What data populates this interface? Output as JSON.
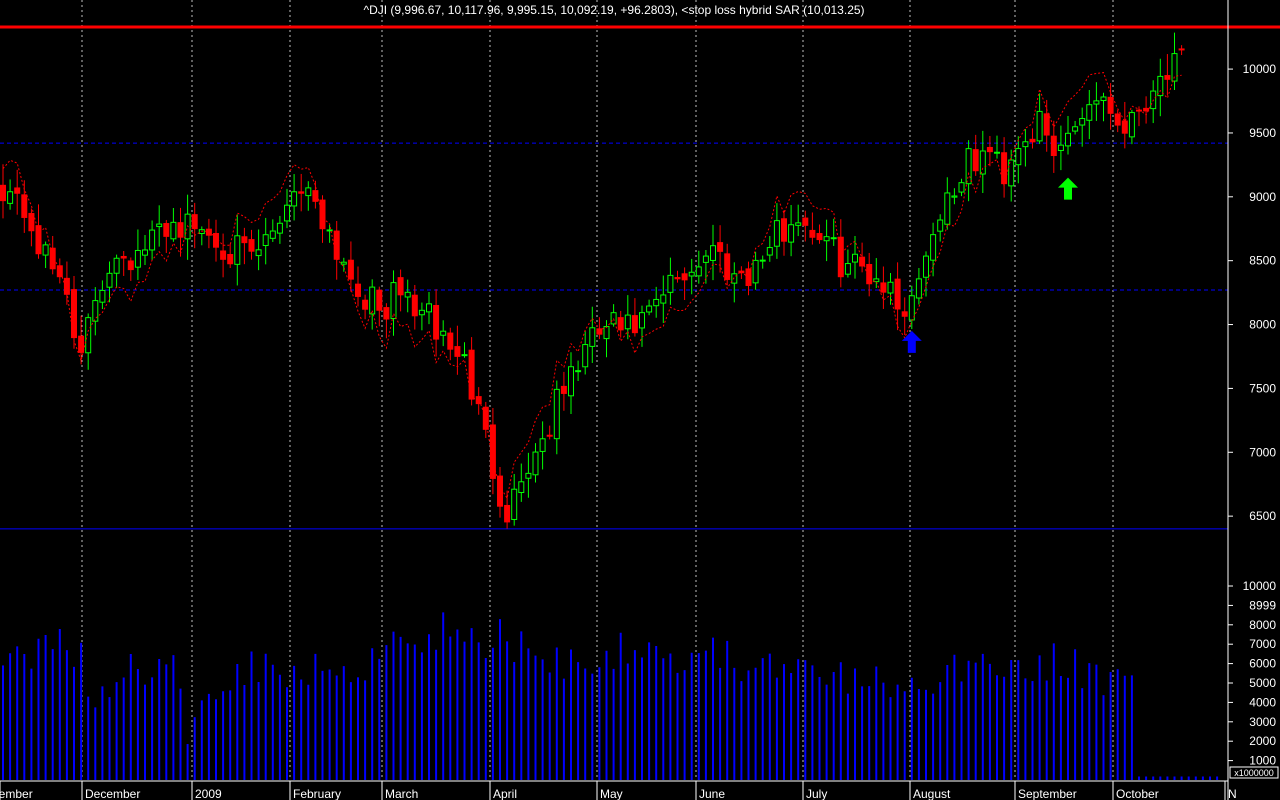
{
  "title": "^DJI (9,996.67, 10,117.96, 9,995.15, 10,092.19, +96.2803), <stop loss hybrid SAR (10,013.25)",
  "colors": {
    "background": "#000000",
    "up": "#00ff00",
    "down": "#ff0000",
    "sar": "#ff0000",
    "volume": "#0000ff",
    "hline": "#0000ff",
    "topline": "#ff0000",
    "grid": "#ffffff",
    "arrow_buy_blue": "#0000ff",
    "arrow_buy_green": "#00ff00"
  },
  "chart_data": [
    {
      "type": "candlestick",
      "series_name": "^DJI",
      "period": "2008-11 to 2009-10",
      "y_ticks": [
        6500,
        7000,
        7500,
        8000,
        8500,
        9000,
        9500,
        10000
      ],
      "ylim": [
        6000,
        10400
      ],
      "x_months": [
        "November",
        "December",
        "2009",
        "February",
        "March",
        "April",
        "May",
        "June",
        "July",
        "August",
        "September",
        "October",
        "N"
      ],
      "price_path": [
        [
          0,
          9100
        ],
        [
          3,
          8900
        ],
        [
          6,
          8500
        ],
        [
          9,
          8300
        ],
        [
          11,
          7700
        ],
        [
          13,
          8200
        ],
        [
          16,
          8600
        ],
        [
          19,
          8500
        ],
        [
          23,
          8800
        ],
        [
          28,
          8750
        ],
        [
          32,
          8600
        ],
        [
          35,
          8500
        ],
        [
          38,
          8700
        ],
        [
          41,
          9100
        ],
        [
          44,
          9000
        ],
        [
          47,
          8600
        ],
        [
          50,
          8300
        ],
        [
          53,
          8100
        ],
        [
          56,
          8250
        ],
        [
          59,
          8100
        ],
        [
          62,
          7900
        ],
        [
          65,
          7700
        ],
        [
          67,
          7300
        ],
        [
          69,
          6900
        ],
        [
          70,
          6700
        ],
        [
          71,
          6550
        ],
        [
          73,
          6800
        ],
        [
          76,
          7100
        ],
        [
          79,
          7500
        ],
        [
          82,
          7800
        ],
        [
          85,
          8000
        ],
        [
          88,
          7950
        ],
        [
          91,
          8050
        ],
        [
          94,
          8300
        ],
        [
          97,
          8450
        ],
        [
          100,
          8600
        ],
        [
          103,
          8400
        ],
        [
          106,
          8450
        ],
        [
          109,
          8700
        ],
        [
          112,
          8850
        ],
        [
          115,
          8700
        ],
        [
          118,
          8500
        ],
        [
          121,
          8450
        ],
        [
          124,
          8350
        ],
        [
          126,
          8150
        ],
        [
          128,
          8200
        ],
        [
          130,
          8600
        ],
        [
          133,
          9000
        ],
        [
          136,
          9250
        ],
        [
          139,
          9350
        ],
        [
          141,
          9200
        ],
        [
          143,
          9450
        ],
        [
          146,
          9550
        ],
        [
          148,
          9300
        ],
        [
          150,
          9500
        ],
        [
          153,
          9750
        ],
        [
          155,
          9800
        ],
        [
          157,
          9600
        ],
        [
          159,
          9600
        ],
        [
          161,
          9800
        ],
        [
          164,
          10000
        ],
        [
          166,
          10050
        ]
      ],
      "sar_start_offset": 250,
      "annotations": [
        {
          "label": "blue-up-arrow",
          "meaning": "buy signal",
          "date": "July",
          "at_bar": 128,
          "below_price": 7950,
          "color": "#0000ff"
        },
        {
          "label": "green-up-arrow",
          "meaning": "buy signal",
          "date": "September",
          "at_bar": 150,
          "below_price": 9150,
          "color": "#00ff00"
        }
      ],
      "horizontal_lines": [
        {
          "value": 10330,
          "color": "#ff0000",
          "style": "solid"
        },
        {
          "value": 9420,
          "color": "#0000ff",
          "style": "dashed"
        },
        {
          "value": 8270,
          "color": "#0000ff",
          "style": "dashed"
        },
        {
          "value": 6400,
          "color": "#0000ff",
          "style": "solid"
        }
      ]
    },
    {
      "type": "bar",
      "series_name": "Volume",
      "unit_label": "x1000000",
      "y_ticks": [
        1000,
        2000,
        3000,
        4000,
        5000,
        6000,
        7000,
        8000,
        8999,
        10000
      ],
      "ylim": [
        0,
        10000
      ],
      "volume_path": [
        [
          0,
          6000
        ],
        [
          5,
          6400
        ],
        [
          8,
          9300
        ],
        [
          11,
          6200
        ],
        [
          13,
          3500
        ],
        [
          16,
          6100
        ],
        [
          20,
          5500
        ],
        [
          24,
          6000
        ],
        [
          26,
          2200
        ],
        [
          28,
          4500
        ],
        [
          31,
          5500
        ],
        [
          36,
          6300
        ],
        [
          41,
          5600
        ],
        [
          46,
          5900
        ],
        [
          51,
          6200
        ],
        [
          55,
          7700
        ],
        [
          58,
          7800
        ],
        [
          62,
          7900
        ],
        [
          65,
          7500
        ],
        [
          68,
          7000
        ],
        [
          71,
          7700
        ],
        [
          73,
          6900
        ],
        [
          75,
          6300
        ],
        [
          78,
          6600
        ],
        [
          81,
          6100
        ],
        [
          84,
          6400
        ],
        [
          88,
          7500
        ],
        [
          91,
          7300
        ],
        [
          95,
          6400
        ],
        [
          99,
          6900
        ],
        [
          103,
          6300
        ],
        [
          107,
          5800
        ],
        [
          111,
          5800
        ],
        [
          115,
          5600
        ],
        [
          118,
          5300
        ],
        [
          121,
          5300
        ],
        [
          124,
          5100
        ],
        [
          127,
          4500
        ],
        [
          130,
          5400
        ],
        [
          133,
          5600
        ],
        [
          136,
          6000
        ],
        [
          139,
          6500
        ],
        [
          142,
          6400
        ],
        [
          145,
          5300
        ],
        [
          148,
          6200
        ],
        [
          151,
          6000
        ],
        [
          154,
          5300
        ],
        [
          156,
          5200
        ],
        [
          158,
          5500
        ],
        [
          159,
          6600
        ]
      ],
      "volume_tail_value": 180
    }
  ]
}
